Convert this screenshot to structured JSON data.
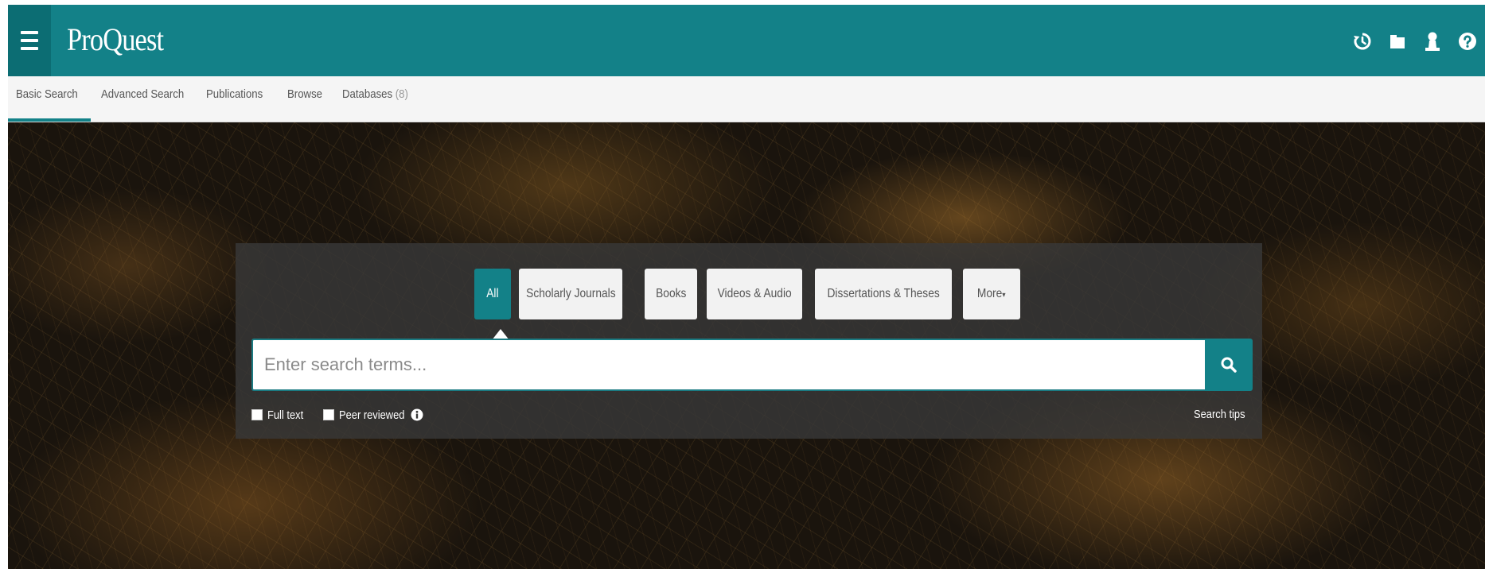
{
  "brand": {
    "name": "ProQuest"
  },
  "top_icons": [
    {
      "icon": "history-icon"
    },
    {
      "icon": "folder-icon"
    },
    {
      "icon": "user-icon"
    },
    {
      "icon": "help-icon"
    }
  ],
  "nav": {
    "basic_search": "Basic Search",
    "advanced_search": "Advanced Search",
    "publications": "Publications",
    "browse": "Browse",
    "databases": "Databases",
    "databases_count": "(8)"
  },
  "filters": {
    "all": "All",
    "scholarly_journals": "Scholarly Journals",
    "books": "Books",
    "videos_audio": "Videos & Audio",
    "dissertations_theses": "Dissertations & Theses",
    "more": "More"
  },
  "search": {
    "placeholder": "Enter search terms...",
    "value": ""
  },
  "options": {
    "full_text": "Full text",
    "peer_reviewed": "Peer reviewed",
    "search_tips": "Search tips"
  },
  "colors": {
    "brand_teal": "#138188",
    "brand_teal_dark": "#0c6d73",
    "subnav_bg": "#f5f5f5",
    "panel_bg": "#383838"
  }
}
